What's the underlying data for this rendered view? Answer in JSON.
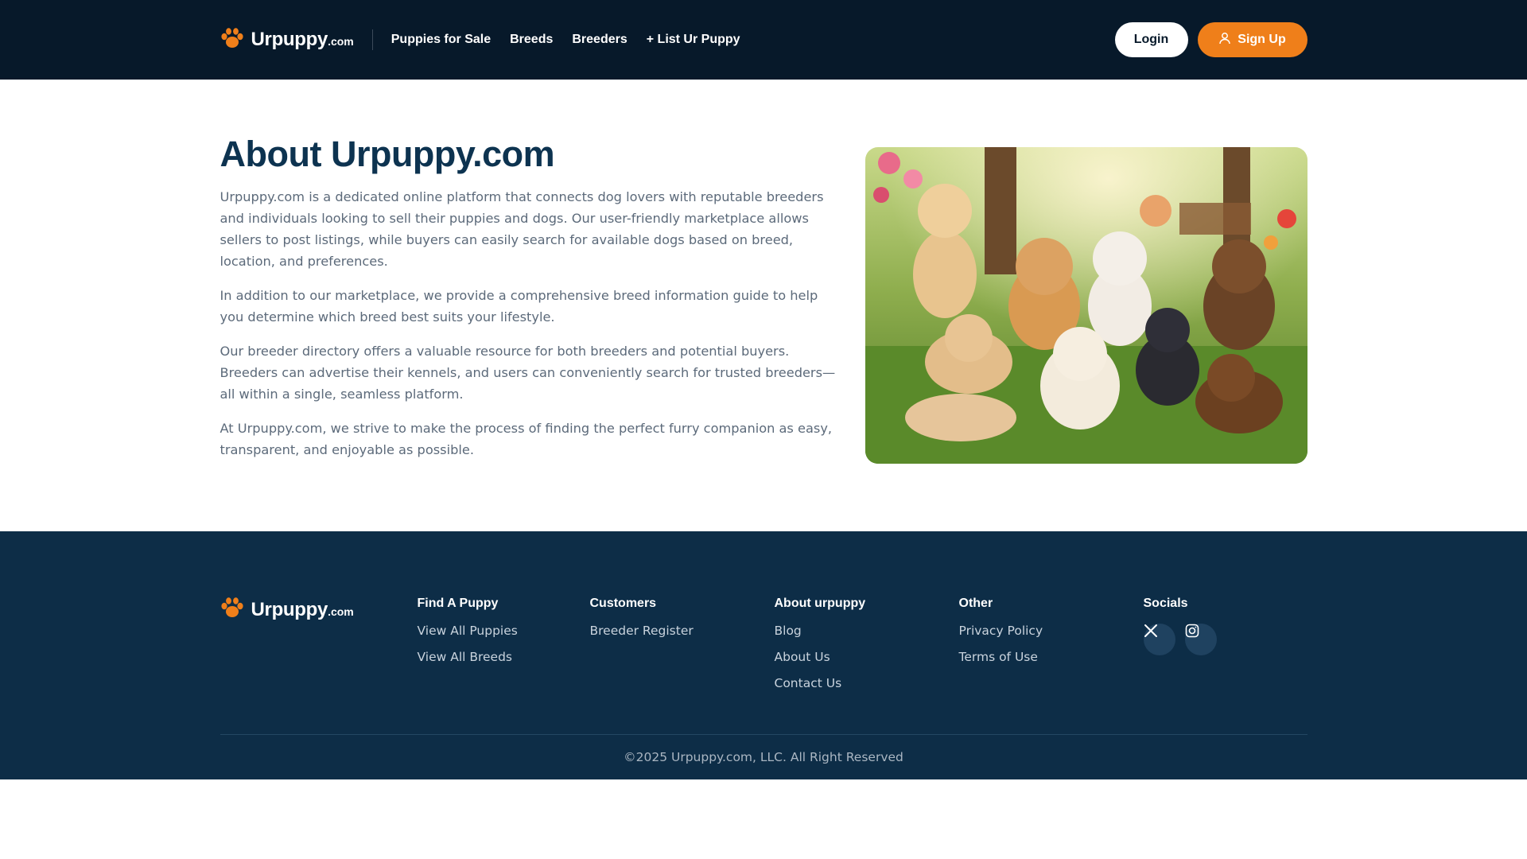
{
  "header": {
    "logo_name": "Urpuppy",
    "logo_tld": ".com",
    "nav": [
      {
        "label": "Puppies for Sale"
      },
      {
        "label": "Breeds"
      },
      {
        "label": "Breeders"
      },
      {
        "label": "+ List Ur Puppy"
      }
    ],
    "login_label": "Login",
    "signup_label": "Sign Up"
  },
  "about": {
    "title": "About Urpuppy.com",
    "paragraphs": [
      "Urpuppy.com is a dedicated online platform that connects dog lovers with reputable breeders and individuals looking to sell their puppies and dogs. Our user-friendly marketplace allows sellers to post listings, while buyers can easily search for available dogs based on breed, location, and preferences.",
      "In addition to our marketplace, we provide a comprehensive breed information guide to help you determine which breed best suits your lifestyle.",
      "Our breeder directory offers a valuable resource for both breeders and potential buyers. Breeders can advertise their kennels, and users can conveniently search for trusted breeders—all within a single, seamless platform.",
      "At Urpuppy.com, we strive to make the process of finding the perfect furry companion as easy, transparent, and enjoyable as possible."
    ]
  },
  "footer": {
    "logo_name": "Urpuppy",
    "logo_tld": ".com",
    "columns": [
      {
        "heading": "Find A Puppy",
        "links": [
          "View All Puppies",
          "View All Breeds"
        ]
      },
      {
        "heading": "Customers",
        "links": [
          "Breeder Register"
        ]
      },
      {
        "heading": "About urpuppy",
        "links": [
          "Blog",
          "About Us",
          "Contact Us"
        ]
      },
      {
        "heading": "Other",
        "links": [
          "Privacy Policy",
          "Terms of Use"
        ]
      }
    ],
    "socials_heading": "Socials",
    "socials": [
      "x-icon",
      "instagram-icon"
    ],
    "copyright": "©2025 Urpuppy.com, LLC. All Right Reserved"
  },
  "colors": {
    "header_bg": "#07192a",
    "footer_bg": "#0d2d47",
    "accent": "#ef7f1a",
    "title": "#0d3350"
  }
}
